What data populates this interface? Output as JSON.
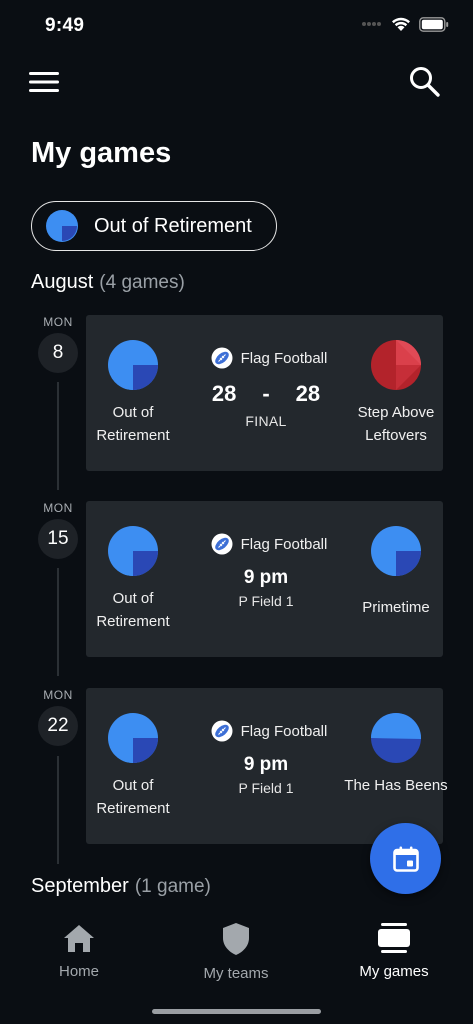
{
  "status_bar": {
    "time": "9:49"
  },
  "header": {
    "title": "My games"
  },
  "team_filter": {
    "label": "Out of Retirement"
  },
  "colors": {
    "accent": "#2f6fe8",
    "card": "#23282d",
    "background": "#0a0e13",
    "home_blue": "#3d8ef2",
    "home_dark": "#2a48b5",
    "away_red": "#c0282f"
  },
  "months": [
    {
      "name": "August",
      "count": "(4 games)"
    },
    {
      "name": "September",
      "count": "(1 game)"
    }
  ],
  "games": [
    {
      "dow": "MON",
      "day": "8",
      "sport": "Flag Football",
      "home": "Out of Retirement",
      "away": "Step Above Leftovers",
      "home_score": "28",
      "separator": "-",
      "away_score": "28",
      "status": "FINAL"
    },
    {
      "dow": "MON",
      "day": "15",
      "sport": "Flag Football",
      "home": "Out of Retirement",
      "away": "Primetime",
      "time": "9 pm",
      "venue": "P Field 1"
    },
    {
      "dow": "MON",
      "day": "22",
      "sport": "Flag Football",
      "home": "Out of Retirement",
      "away": "The Has Beens",
      "time": "9 pm",
      "venue": "P Field 1"
    }
  ],
  "bottom_nav": [
    {
      "label": "Home",
      "icon": "home-icon"
    },
    {
      "label": "My teams",
      "icon": "shield-icon"
    },
    {
      "label": "My games",
      "icon": "games-icon",
      "active": true
    }
  ]
}
